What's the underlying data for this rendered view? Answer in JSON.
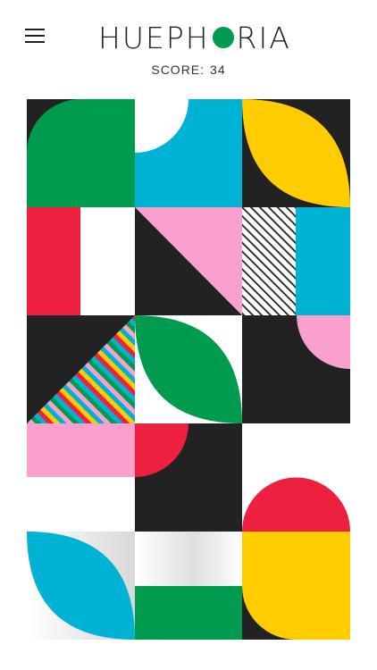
{
  "app": {
    "logo_left": "HUEPH",
    "logo_right": "RIA"
  },
  "score": {
    "label": "SCORE:",
    "value": "34"
  },
  "colors": {
    "black": "#222222",
    "white": "#ffffff",
    "green": "#009b4e",
    "cyan": "#00b3d5",
    "yellow": "#ffcc00",
    "red": "#ee2040",
    "pink": "#f9a0cf"
  },
  "icons": {
    "menu": "hamburger-menu-icon",
    "logo_o": "green-circle-icon"
  },
  "board": {
    "rows": 5,
    "columns": 3
  }
}
